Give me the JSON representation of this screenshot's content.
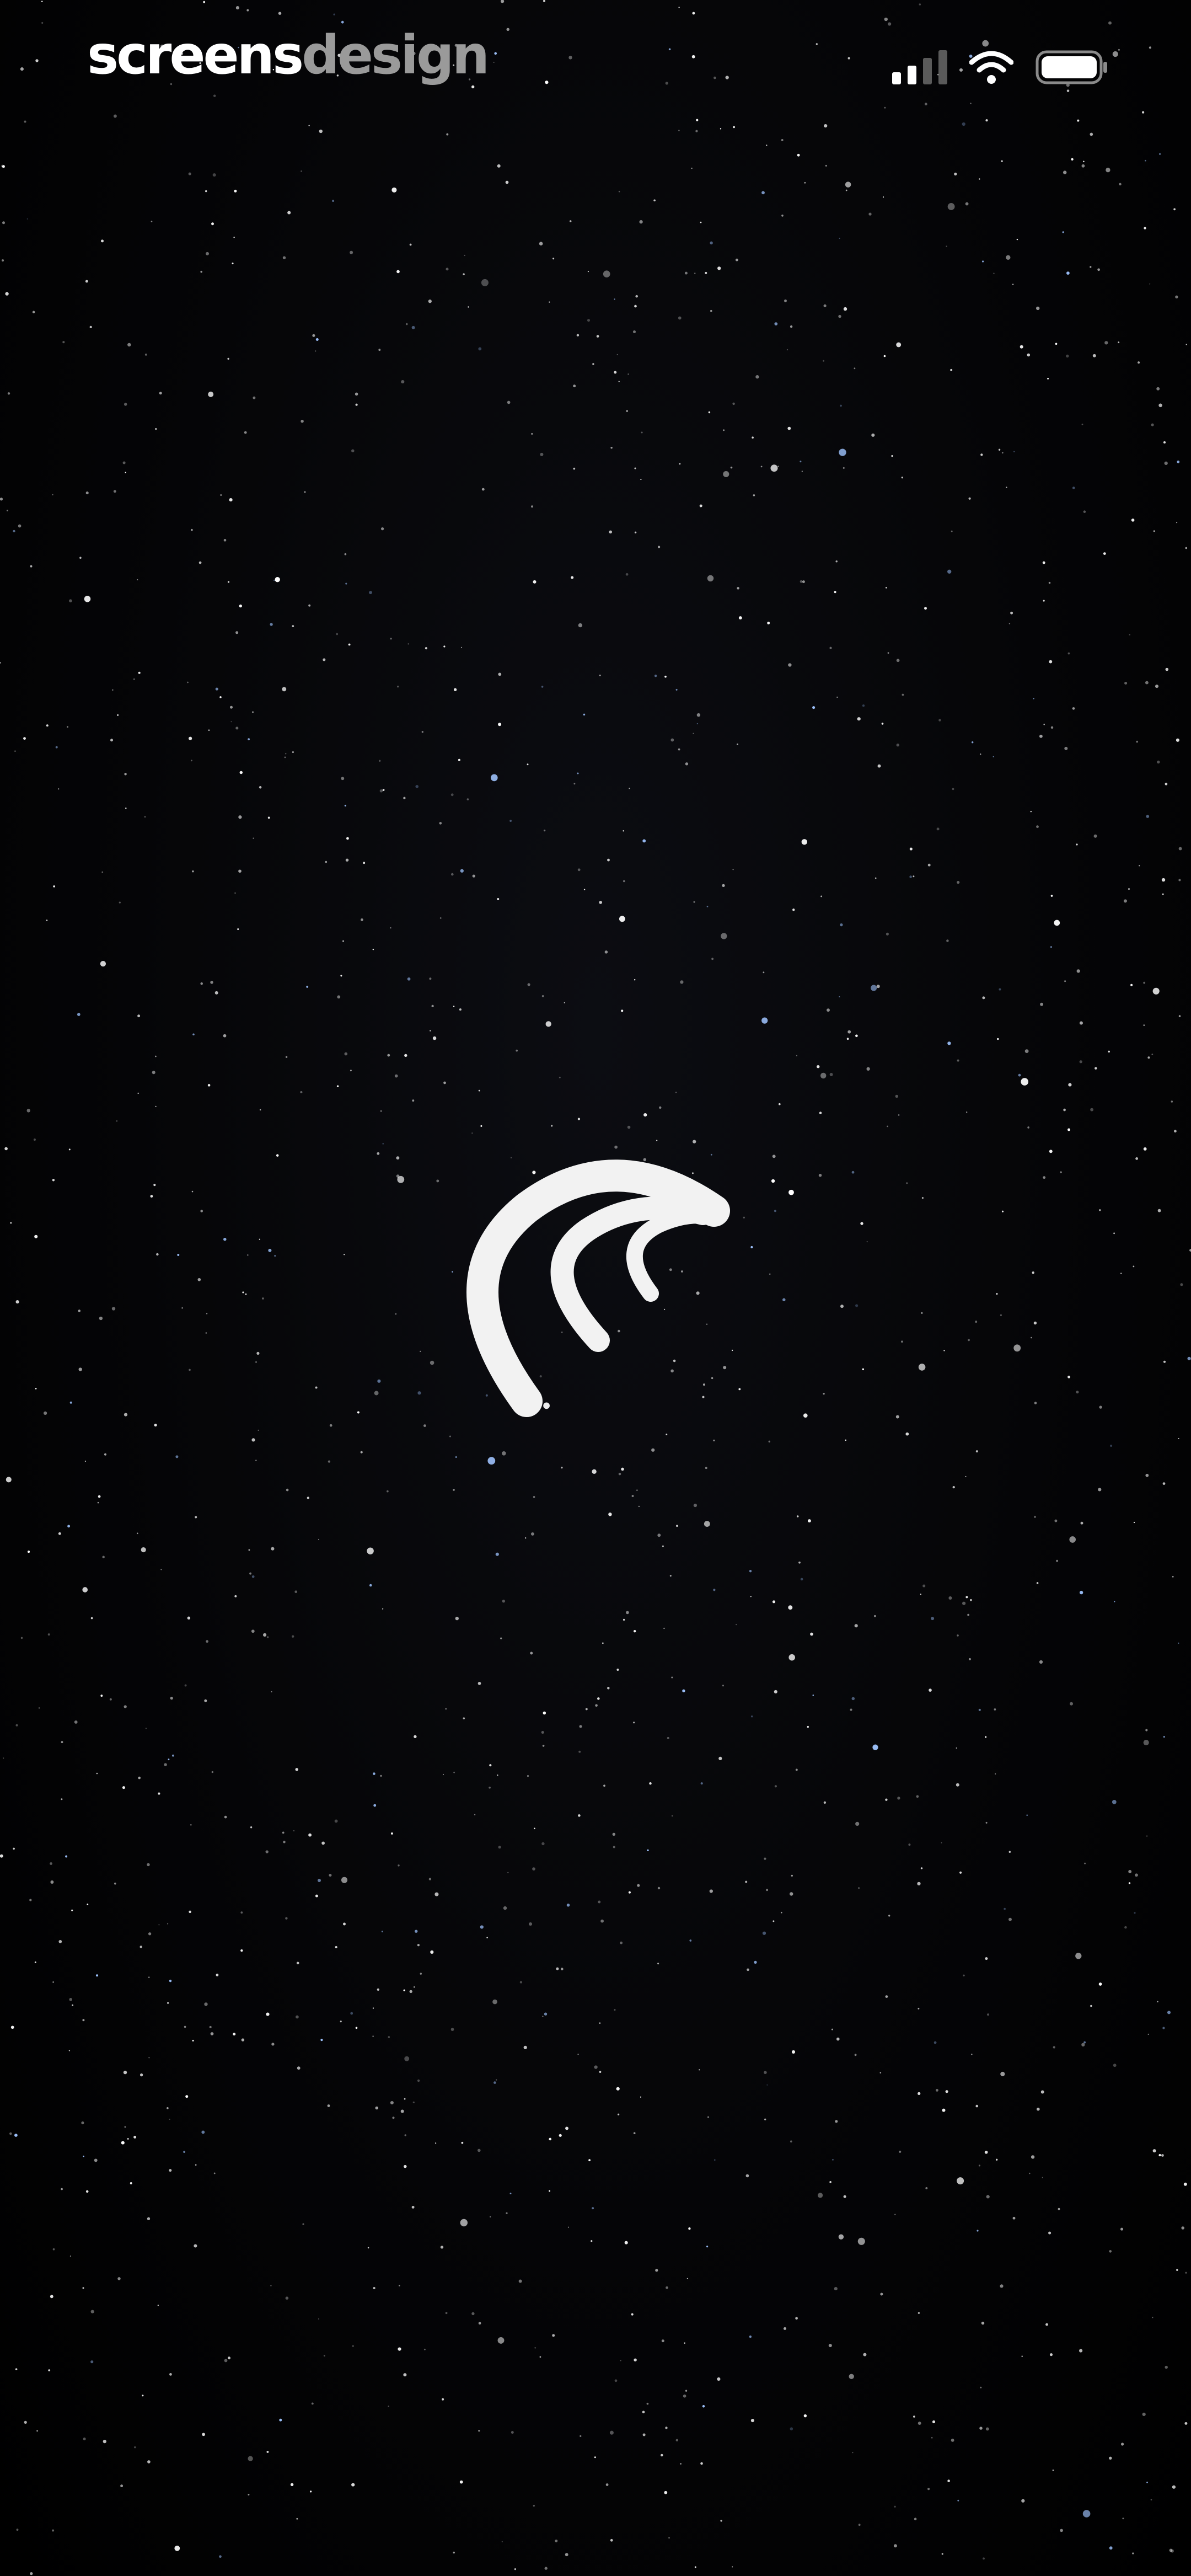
{
  "watermark": {
    "part1": "screens",
    "part2": "design"
  },
  "status_bar": {
    "icons": [
      "cellular-signal-icon",
      "wifi-icon",
      "battery-icon"
    ],
    "battery_level": 1.0
  },
  "splash": {
    "logo_icon": "wave-arcs-logo-icon",
    "logo_color": "#f2f2f2"
  },
  "colors": {
    "background": "#000000",
    "star": "#ffffff",
    "star_blue": "#9fc4ff",
    "watermark_primary": "#ffffff",
    "watermark_secondary": "#9a9a9a"
  }
}
